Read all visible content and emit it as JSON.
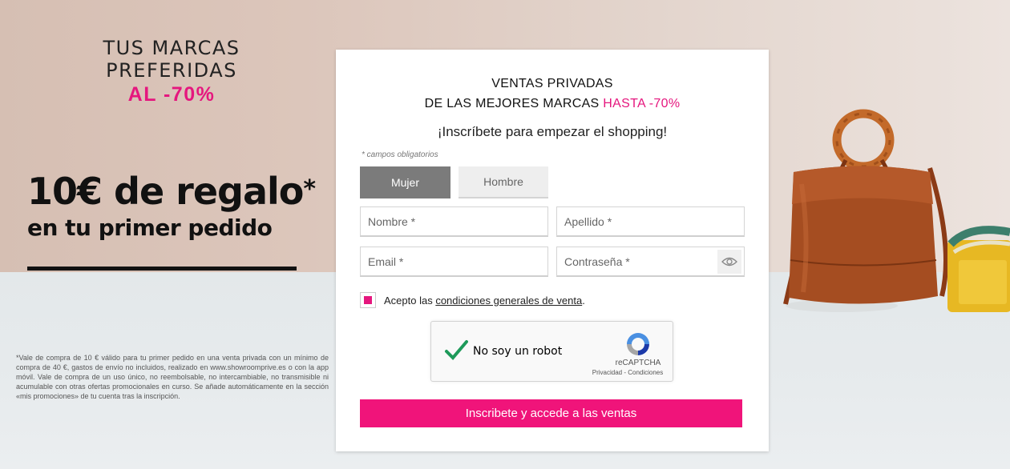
{
  "promo": {
    "line1": "TUS MARCAS PREFERIDAS",
    "line2": "AL -70%",
    "gift_main": "10€ de regalo",
    "gift_star": "*",
    "gift_sub": "en tu primer pedido",
    "legal": "*Vale de compra de 10 € válido para tu primer pedido en una venta privada con un mínimo de compra de 40 €, gastos de envío no incluidos, realizado en www.showroomprive.es o con la app móvil. Vale de compra de un uso único, no reembolsable, no intercambiable, no transmisible ni acumulable con otras ofertas promocionales en curso. Se añade automáticamente en la sección «mis promociones» de tu cuenta tras la inscripción."
  },
  "form": {
    "title_line1": "VENTAS PRIVADAS",
    "title_line2_prefix": "DE LAS MEJORES MARCAS ",
    "title_line2_highlight": "HASTA -70%",
    "subtitle": "¡Inscríbete para empezar el shopping!",
    "required_note": "* campos obligatorios",
    "gender_options": [
      "Mujer",
      "Hombre"
    ],
    "gender_selected": "Mujer",
    "fields": {
      "first_name_placeholder": "Nombre *",
      "last_name_placeholder": "Apellido *",
      "email_placeholder": "Email *",
      "password_placeholder": "Contraseña *"
    },
    "terms_prefix": "Acepto las ",
    "terms_link": "condiciones generales de venta",
    "terms_suffix": ".",
    "terms_checked": true,
    "captcha": {
      "label": "No soy un robot",
      "checked": true,
      "brand": "reCAPTCHA",
      "privacy": "Privacidad",
      "separator": " - ",
      "terms": "Condiciones"
    },
    "submit_label": "Inscribete y accede a las ventas"
  },
  "colors": {
    "accent": "#e5177e",
    "button": "#f0147a",
    "gender_active": "#7b7b7b",
    "captcha_check": "#1e9a5a"
  },
  "icons": {
    "password_toggle": "eye-icon",
    "captcha_logo": "recaptcha-icon",
    "captcha_check": "checkmark-icon"
  }
}
